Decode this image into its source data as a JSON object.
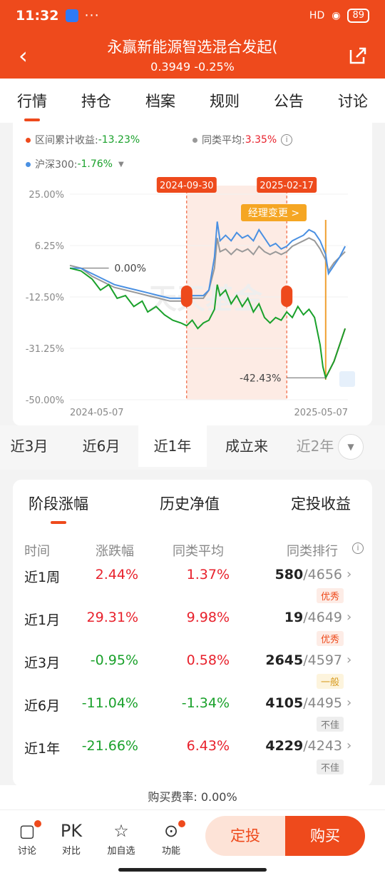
{
  "status": {
    "time": "11:32",
    "dots": "···",
    "signal": "HD",
    "battery": "89"
  },
  "header": {
    "title": "永赢新能源智选混合发起(",
    "subtitle": "0.3949 -0.25%"
  },
  "tabs": [
    "行情",
    "持仓",
    "档案",
    "规则",
    "公告",
    "讨论"
  ],
  "chart_legend": {
    "range_return_label": "区间累计收益:",
    "range_return_value": "-13.23%",
    "peer_avg_label": "同类平均:",
    "peer_avg_value": "3.35%",
    "index_label": "沪深300:",
    "index_value": "-1.76%"
  },
  "chart_data": {
    "type": "line",
    "y_ticks": [
      "25.00%",
      "6.25%",
      "-12.50%",
      "-31.25%",
      "-50.00%"
    ],
    "ylim": [
      -50,
      25
    ],
    "x_ticks": [
      "2024-05-07",
      "2025-05-07"
    ],
    "markers": [
      "2024-09-30",
      "2025-02-17"
    ],
    "annotation": "经理变更 >",
    "zero_label": "0.00%",
    "min_label": "-42.43%",
    "watermark": "天天基金",
    "series": [
      {
        "color": "#1aa12b",
        "points": [
          [
            0,
            -2
          ],
          [
            4,
            -3
          ],
          [
            8,
            -6
          ],
          [
            11,
            -10
          ],
          [
            14,
            -8
          ],
          [
            17,
            -13
          ],
          [
            20,
            -12
          ],
          [
            23,
            -16
          ],
          [
            26,
            -14
          ],
          [
            28,
            -18
          ],
          [
            31,
            -16
          ],
          [
            34,
            -19
          ],
          [
            37,
            -21
          ],
          [
            40,
            -22
          ],
          [
            42,
            -23
          ],
          [
            44,
            -21
          ],
          [
            46,
            -24
          ],
          [
            48,
            -22
          ],
          [
            50,
            -21
          ],
          [
            52,
            -17
          ],
          [
            53,
            -8
          ],
          [
            54,
            -12
          ],
          [
            56,
            -10
          ],
          [
            58,
            -15
          ],
          [
            60,
            -12
          ],
          [
            62,
            -16
          ],
          [
            64,
            -13
          ],
          [
            66,
            -18
          ],
          [
            68,
            -15
          ],
          [
            70,
            -20
          ],
          [
            72,
            -22
          ],
          [
            74,
            -20
          ],
          [
            76,
            -21
          ],
          [
            78,
            -18
          ],
          [
            80,
            -20
          ],
          [
            82,
            -16
          ],
          [
            84,
            -19
          ],
          [
            86,
            -17
          ],
          [
            88,
            -20
          ],
          [
            89,
            -25
          ],
          [
            90,
            -30
          ],
          [
            91,
            -38
          ],
          [
            92,
            -42
          ],
          [
            93,
            -40
          ],
          [
            95,
            -36
          ],
          [
            97,
            -30
          ],
          [
            99,
            -24
          ]
        ]
      },
      {
        "color": "#e8212c",
        "points": [
          [
            92,
            -42
          ],
          [
            93,
            -40
          ],
          [
            95,
            -36
          ],
          [
            97,
            -30
          ],
          [
            99,
            -24
          ]
        ]
      },
      {
        "color": "#4a90e2",
        "points": [
          [
            0,
            -2
          ],
          [
            4,
            -2
          ],
          [
            8,
            -4
          ],
          [
            12,
            -6
          ],
          [
            16,
            -8
          ],
          [
            20,
            -9
          ],
          [
            24,
            -10
          ],
          [
            28,
            -11
          ],
          [
            32,
            -12
          ],
          [
            36,
            -13
          ],
          [
            40,
            -13
          ],
          [
            44,
            -12
          ],
          [
            48,
            -12
          ],
          [
            50,
            -10
          ],
          [
            52,
            2
          ],
          [
            53,
            15
          ],
          [
            54,
            8
          ],
          [
            56,
            10
          ],
          [
            58,
            8
          ],
          [
            60,
            11
          ],
          [
            62,
            9
          ],
          [
            64,
            10
          ],
          [
            66,
            8
          ],
          [
            68,
            12
          ],
          [
            70,
            9
          ],
          [
            72,
            6
          ],
          [
            74,
            7
          ],
          [
            76,
            5
          ],
          [
            78,
            6
          ],
          [
            80,
            8
          ],
          [
            82,
            9
          ],
          [
            84,
            10
          ],
          [
            86,
            12
          ],
          [
            88,
            11
          ],
          [
            90,
            8
          ],
          [
            92,
            3
          ],
          [
            93,
            -4
          ],
          [
            95,
            -1
          ],
          [
            97,
            2
          ],
          [
            99,
            6
          ]
        ]
      },
      {
        "color": "#999999",
        "points": [
          [
            0,
            -1
          ],
          [
            4,
            -2
          ],
          [
            8,
            -5
          ],
          [
            12,
            -7
          ],
          [
            16,
            -9
          ],
          [
            20,
            -10
          ],
          [
            24,
            -11
          ],
          [
            28,
            -12
          ],
          [
            32,
            -13
          ],
          [
            36,
            -14
          ],
          [
            40,
            -14
          ],
          [
            44,
            -13
          ],
          [
            48,
            -13
          ],
          [
            50,
            -10
          ],
          [
            52,
            -2
          ],
          [
            53,
            9
          ],
          [
            54,
            4
          ],
          [
            56,
            5
          ],
          [
            58,
            3
          ],
          [
            60,
            5
          ],
          [
            62,
            4
          ],
          [
            64,
            5
          ],
          [
            66,
            3
          ],
          [
            68,
            6
          ],
          [
            70,
            4
          ],
          [
            72,
            3
          ],
          [
            74,
            4
          ],
          [
            76,
            3
          ],
          [
            78,
            4
          ],
          [
            80,
            6
          ],
          [
            82,
            7
          ],
          [
            84,
            8
          ],
          [
            86,
            9
          ],
          [
            88,
            8
          ],
          [
            90,
            5
          ],
          [
            92,
            1
          ],
          [
            93,
            -3
          ],
          [
            95,
            0
          ],
          [
            97,
            2
          ],
          [
            99,
            4
          ]
        ]
      }
    ]
  },
  "periods": [
    "近3月",
    "近6月",
    "近1年",
    "成立来",
    "近2年"
  ],
  "perf_tabs": [
    "阶段涨幅",
    "历史净值",
    "定投收益"
  ],
  "table_headers": [
    "时间",
    "涨跌幅",
    "同类平均",
    "同类排行"
  ],
  "rows": [
    {
      "period": "近1周",
      "change": "2.44%",
      "avg": "1.37%",
      "rank": "580",
      "total": "/4656",
      "tag": "优秀"
    },
    {
      "period": "近1月",
      "change": "29.31%",
      "avg": "9.98%",
      "rank": "19",
      "total": "/4649",
      "tag": "优秀"
    },
    {
      "period": "近3月",
      "change": "-0.95%",
      "avg": "0.58%",
      "rank": "2645",
      "total": "/4597",
      "tag": "一般"
    },
    {
      "period": "近6月",
      "change": "-11.04%",
      "avg": "-1.34%",
      "rank": "4105",
      "total": "/4495",
      "tag": "不佳"
    },
    {
      "period": "近1年",
      "change": "-21.66%",
      "avg": "6.43%",
      "rank": "4229",
      "total": "/4243",
      "tag": "不佳"
    }
  ],
  "fee": "购买费率: 0.00%",
  "bottom": {
    "discuss": "讨论",
    "pk_icon": "PK",
    "compare": "对比",
    "watch": "加自选",
    "func": "功能",
    "dingtou": "定投",
    "buy": "购买"
  }
}
